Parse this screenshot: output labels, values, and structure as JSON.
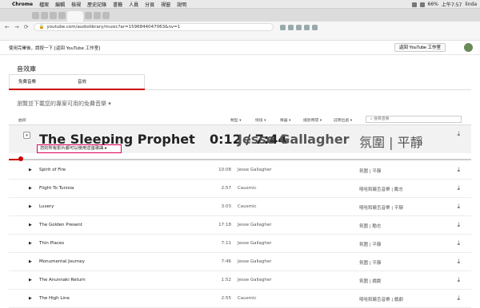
{
  "browser": {
    "menubar": {
      "app": "Chrome",
      "items": [
        "檔案",
        "編輯",
        "檢視",
        "歷史記錄",
        "書籤",
        "人員",
        "分頁",
        "視窗",
        "說明"
      ],
      "clock": "上午7:57",
      "user": "linda",
      "battery": "66%"
    },
    "url": "youtube.com/audiolibrary/music?ar=1596844047063&nv=1"
  },
  "studio": {
    "title": "使用完畢後，請按一下 [返回 YouTube 工作室]",
    "back_button": "返回 YouTube 工作室"
  },
  "library": {
    "section_title": "音效庫",
    "tabs": [
      "免費音樂",
      "音效"
    ],
    "browse_text": "瀏覽並下載您的專案可用的免費音樂 ▾",
    "filters": {
      "track": "曲目",
      "genre": "類型 ▾",
      "mood": "情境 ▾",
      "instrument": "樂器 ▾",
      "duration": "播放時間 ▾",
      "attribution": "註明出處 ▾"
    },
    "search_placeholder": "搜尋音樂",
    "playing": {
      "title": "The Sleeping Prophet",
      "time": "0:12 / 7:44",
      "progress": 0.026,
      "artist": "Jesse Gallagher",
      "genre": "氛圍 | 平靜",
      "license": "您的所有影片都可以使用這首歌曲 ▸"
    },
    "tracks": [
      {
        "title": "Spirit of Fire",
        "duration": "10:08",
        "artist": "Jesse Gallagher",
        "genre": "氛圍 | 平靜"
      },
      {
        "title": "Flight To Tunisia",
        "duration": "2:57",
        "artist": "Causmic",
        "genre": "嘻哈和饒舌音樂 | 勵志"
      },
      {
        "title": "Luxery",
        "duration": "3:03",
        "artist": "Causmic",
        "genre": "嘻哈和饒舌音樂 | 平靜"
      },
      {
        "title": "The Golden Present",
        "duration": "17:18",
        "artist": "Jesse Gallagher",
        "genre": "氛圍 | 勵志"
      },
      {
        "title": "Thin Places",
        "duration": "7:11",
        "artist": "Jesse Gallagher",
        "genre": "氛圍 | 平靜"
      },
      {
        "title": "Monumental Journey",
        "duration": "7:46",
        "artist": "Jesse Gallagher",
        "genre": "氛圍 | 平靜"
      },
      {
        "title": "The Anunnaki Return",
        "duration": "1:52",
        "artist": "Jesse Gallagher",
        "genre": "氛圍 | 戲劇"
      },
      {
        "title": "The High Line",
        "duration": "2:55",
        "artist": "Causmic",
        "genre": "嘻哈和饒舌音樂 | 戲劇"
      }
    ]
  },
  "icons": {
    "play": "play-icon",
    "pause": "pause-icon",
    "download": "download-icon",
    "search": "search-icon"
  },
  "colors": {
    "accent": "#c00000",
    "highlight": "#e0005a"
  }
}
